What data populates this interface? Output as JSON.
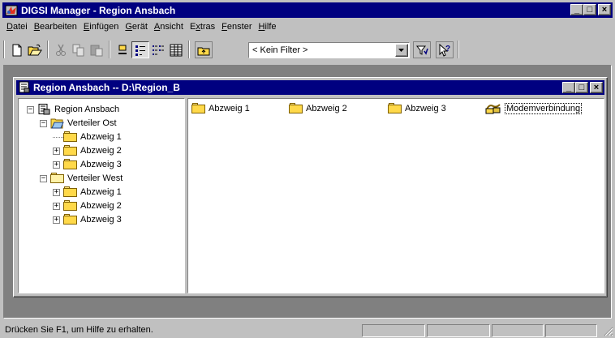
{
  "app": {
    "title": "DIGSI Manager - Region Ansbach",
    "window_controls": {
      "minimize": "_",
      "maximize": "□",
      "close": "×"
    }
  },
  "menu": [
    {
      "label": "Datei",
      "accel": "D"
    },
    {
      "label": "Bearbeiten",
      "accel": "B"
    },
    {
      "label": "Einfügen",
      "accel": "E"
    },
    {
      "label": "Gerät",
      "accel": "G"
    },
    {
      "label": "Ansicht",
      "accel": "A"
    },
    {
      "label": "Extras",
      "accel": "x"
    },
    {
      "label": "Fenster",
      "accel": "F"
    },
    {
      "label": "Hilfe",
      "accel": "H"
    }
  ],
  "toolbar": {
    "buttons": [
      "new-icon",
      "open-icon",
      "cut-icon",
      "copy-icon",
      "paste-icon",
      "large-icons-icon",
      "small-icons-icon",
      "list-view-icon",
      "details-view-icon",
      "up-level-icon",
      "filter-icon",
      "help-context-icon"
    ],
    "filter": {
      "value": "< Kein Filter >"
    }
  },
  "child_window": {
    "title": "Region Ansbach -- D:\\Region_B"
  },
  "tree": {
    "root": "Region Ansbach",
    "nodes": [
      {
        "label": "Verteiler Ost",
        "expander": "−",
        "children": [
          {
            "label": "Abzweig 1",
            "expander": ""
          },
          {
            "label": "Abzweig 2",
            "expander": "+"
          },
          {
            "label": "Abzweig 3",
            "expander": "+"
          }
        ]
      },
      {
        "label": "Verteiler West",
        "expander": "−",
        "children": [
          {
            "label": "Abzweig 1",
            "expander": "+"
          },
          {
            "label": "Abzweig 2",
            "expander": "+"
          },
          {
            "label": "Abzweig 3",
            "expander": "+"
          }
        ]
      }
    ],
    "root_expander": "−"
  },
  "list": {
    "items": [
      {
        "label": "Abzweig 1",
        "icon": "folder-icon"
      },
      {
        "label": "Abzweig 2",
        "icon": "folder-icon"
      },
      {
        "label": "Abzweig 3",
        "icon": "folder-icon"
      },
      {
        "label": "Modemverbindung",
        "icon": "modem-connection-icon"
      }
    ]
  },
  "status": {
    "text": "Drücken Sie F1, um Hilfe zu erhalten."
  },
  "colors": {
    "titlebar": "#000080",
    "face": "#c0c0c0",
    "workspace": "#808080",
    "folder": "#ffd94a"
  }
}
